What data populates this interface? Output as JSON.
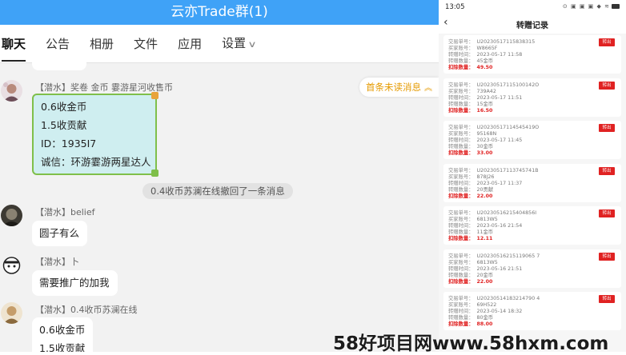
{
  "chat": {
    "title": "云亦Trade群(1)",
    "tabs": [
      {
        "label": "聊天"
      },
      {
        "label": "公告"
      },
      {
        "label": "相册"
      },
      {
        "label": "文件"
      },
      {
        "label": "应用"
      },
      {
        "label": "设置"
      }
    ],
    "unread_pill": "首条未读消息",
    "system_note": "0.4收币苏澜在线撤回了一条消息",
    "messages": [
      {
        "sender": "【潜水】奖卷 金币 霎游星河收售币",
        "lines": [
          "0.6收金币",
          "1.5收贡献",
          "ID：1935I7",
          "诚信：环游霎游两星达人"
        ]
      },
      {
        "sender": "【潜水】belief",
        "lines": [
          "圆子有么"
        ]
      },
      {
        "sender": "【潜水】卜",
        "lines": [
          "需要推广的加我"
        ]
      },
      {
        "sender": "【潜水】0.4收币苏澜在线",
        "lines": [
          "0.6收金币",
          "1.5收贡献"
        ]
      }
    ]
  },
  "phone": {
    "status_time": "13:05",
    "status_icons": "⊙ ▣ ▣ ▣ ◆ ≋",
    "title": "转赠记录",
    "back_icon": "‹",
    "labels": {
      "order": "交易单号：",
      "buyer": "买家账号：",
      "time": "转赠时间：",
      "qty": "转赠数量：",
      "deduct": "扣除数量："
    },
    "records": [
      {
        "order": "U20230517115838315",
        "buyer": "W8665F",
        "time": "2023-05-17 11:58",
        "qty": "45金币",
        "deduct": "49.50",
        "tag": "转出"
      },
      {
        "order": "U20230517115100142O",
        "buyer": "739A42",
        "time": "2023-05-17 11:51",
        "qty": "15金币",
        "deduct": "16.50",
        "tag": "转出"
      },
      {
        "order": "U20230517114545419O",
        "buyer": "95168N",
        "time": "2023-05-17 11:45",
        "qty": "30金币",
        "deduct": "33.00",
        "tag": "转出"
      },
      {
        "order": "U20230517113745741B",
        "buyer": "878J26",
        "time": "2023-05-17 11:37",
        "qty": "20贡献",
        "deduct": "22.00",
        "tag": "转出"
      },
      {
        "order": "U20230516215404856I",
        "buyer": "6813W5",
        "time": "2023-05-16 21:54",
        "qty": "11金币",
        "deduct": "12.11",
        "tag": "转出"
      },
      {
        "order": "U20230516215119065 7",
        "buyer": "6813W5",
        "time": "2023-05-16 21:51",
        "qty": "20金币",
        "deduct": "22.00",
        "tag": "转出"
      },
      {
        "order": "U20230514183214790 4",
        "buyer": "69H522",
        "time": "2023-05-14 18:32",
        "qty": "80金币",
        "deduct": "88.00",
        "tag": "转出"
      }
    ]
  },
  "watermark": "58好项目网www.58hxm.com",
  "colors": {
    "header_blue": "#3fa2f7",
    "accent_red": "#e02222",
    "unread_orange": "#e59a00"
  }
}
